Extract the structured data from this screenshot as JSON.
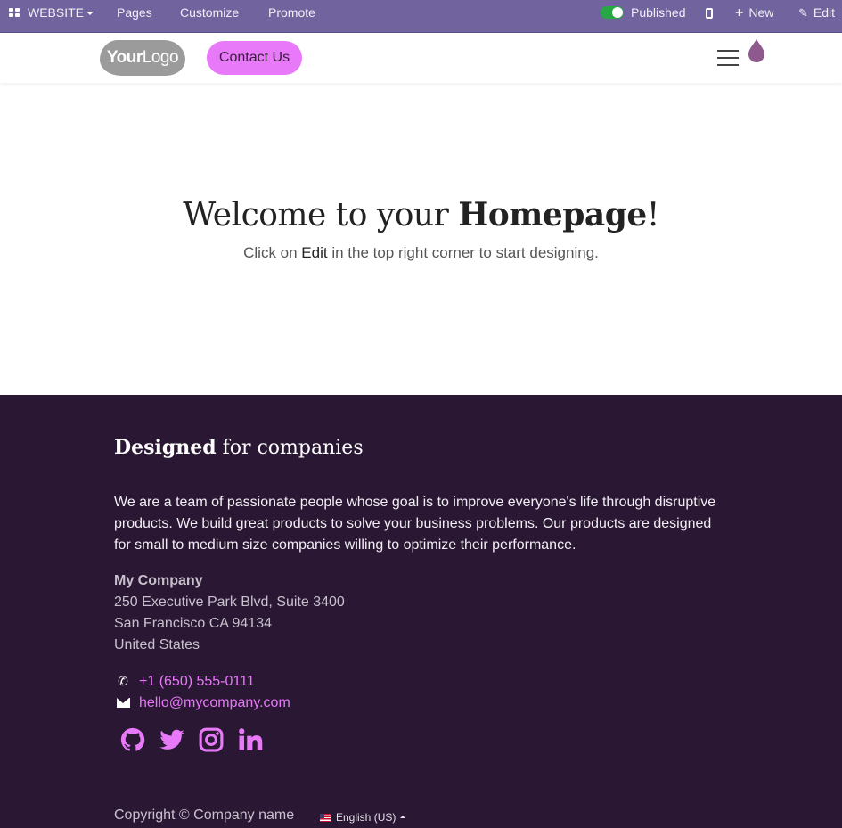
{
  "admin_bar": {
    "app_menu_label": "WEBSITE",
    "menu_items": [
      "Pages",
      "Customize",
      "Promote"
    ],
    "published_label": "Published",
    "new_label": "New",
    "edit_label": "Edit"
  },
  "header": {
    "logo_text_bold": "Your",
    "logo_text": "Logo",
    "contact_button": "Contact Us"
  },
  "hero": {
    "title_regular": "Welcome to your ",
    "title_bold": "Homepage",
    "title_end": "!",
    "subtitle_before": "Click on ",
    "subtitle_bold": "Edit",
    "subtitle_after": " in the top right corner to start designing."
  },
  "footer": {
    "title_bold": "Designed",
    "title_rest": " for companies",
    "description": "We are a team of passionate people whose goal is to improve everyone's life through disruptive products. We build great products to solve your business problems. Our products are designed for small to medium size companies willing to optimize their performance.",
    "company_name": "My Company",
    "address_line1": "250 Executive Park Blvd, Suite 3400",
    "address_line2": "San Francisco CA 94134",
    "address_line3": "United States",
    "phone": "+1 (650) 555-0111",
    "email": "hello@mycompany.com",
    "social_icons": [
      "github-icon",
      "twitter-icon",
      "instagram-icon",
      "linkedin-icon"
    ],
    "copyright": "Copyright © Company name",
    "language": "English (US)"
  },
  "colors": {
    "admin_bar": "#71639e",
    "accent": "#e879f9",
    "footer_bg": "#2a1733",
    "toggle_on": "#28a745"
  }
}
